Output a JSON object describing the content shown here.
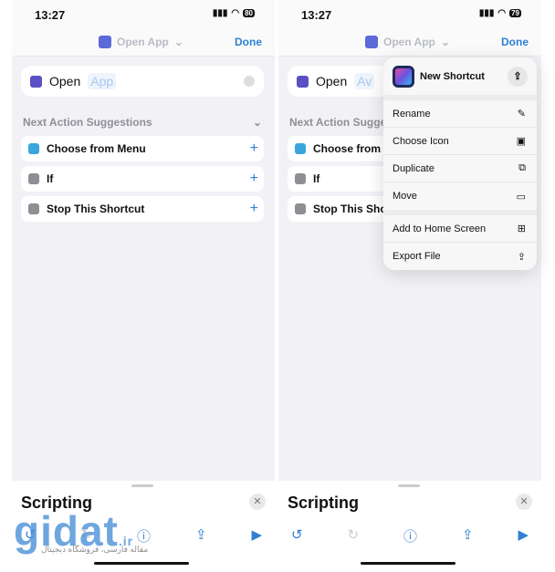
{
  "screens": [
    {
      "time": "13:27",
      "battery": "80",
      "nav_title": "Open App",
      "done": "Done",
      "open_label": "Open",
      "open_param": "App",
      "suggestions_header": "Next Action Suggestions",
      "suggestions": [
        {
          "label": "Choose from Menu",
          "color": "#3aa6dd"
        },
        {
          "label": "If",
          "color": "#8e8e93"
        },
        {
          "label": "Stop This Shortcut",
          "color": "#8e8e93"
        }
      ],
      "sheet_title": "Scripting"
    },
    {
      "time": "13:27",
      "battery": "79",
      "nav_title": "Open App",
      "done": "Done",
      "open_label": "Open",
      "open_param": "Av",
      "suggestions_header": "Next Action Sugge",
      "suggestions": [
        {
          "label": "Choose from",
          "color": "#3aa6dd"
        },
        {
          "label": "If",
          "color": "#8e8e93"
        },
        {
          "label": "Stop This Sho",
          "color": "#8e8e93"
        }
      ],
      "sheet_title": "Scripting"
    }
  ],
  "menu": {
    "title": "New Shortcut",
    "items": [
      {
        "label": "Rename",
        "icon": "✎"
      },
      {
        "label": "Choose Icon",
        "icon": "▣"
      },
      {
        "label": "Duplicate",
        "icon": "⧉"
      },
      {
        "label": "Move",
        "icon": "▭"
      }
    ],
    "items2": [
      {
        "label": "Add to Home Screen",
        "icon": "⊞"
      },
      {
        "label": "Export File",
        "icon": "⇪"
      }
    ]
  },
  "watermark": {
    "logo": "gidat.ir",
    "tagline": "مقاله فارسی، فروشگاه دیجیتال"
  },
  "accent": "#2f7fd4"
}
